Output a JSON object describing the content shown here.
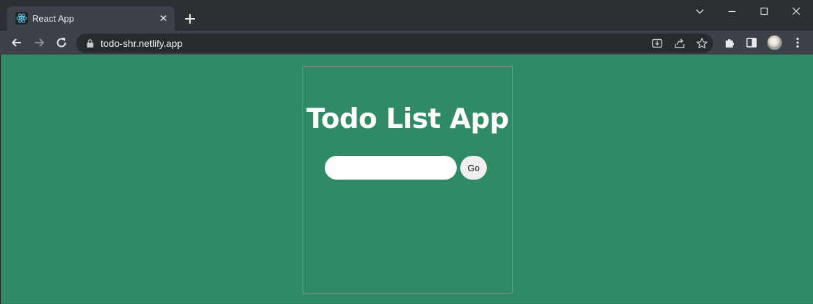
{
  "browser": {
    "tab": {
      "title": "React App",
      "close_symbol": "✕",
      "favicon": "react-logo-icon"
    },
    "new_tab_icon": "plus-icon",
    "window_controls": [
      "tab-search-icon",
      "minimize-icon",
      "maximize-icon",
      "close-icon"
    ],
    "toolbar": {
      "back_icon": "back-arrow-icon",
      "forward_icon": "forward-arrow-icon",
      "reload_icon": "reload-icon",
      "url": "todo-shr.netlify.app",
      "omnibox_icons": [
        "install-app-icon",
        "share-icon",
        "star-icon"
      ],
      "extensions_icon": "puzzle-icon",
      "side_panel_icon": "side-panel-icon",
      "menu_icon": "more-vert-icon"
    }
  },
  "page": {
    "background_color": "#318a66",
    "title": "Todo List App",
    "input": {
      "value": "",
      "placeholder": ""
    },
    "go_button_label": "Go"
  }
}
